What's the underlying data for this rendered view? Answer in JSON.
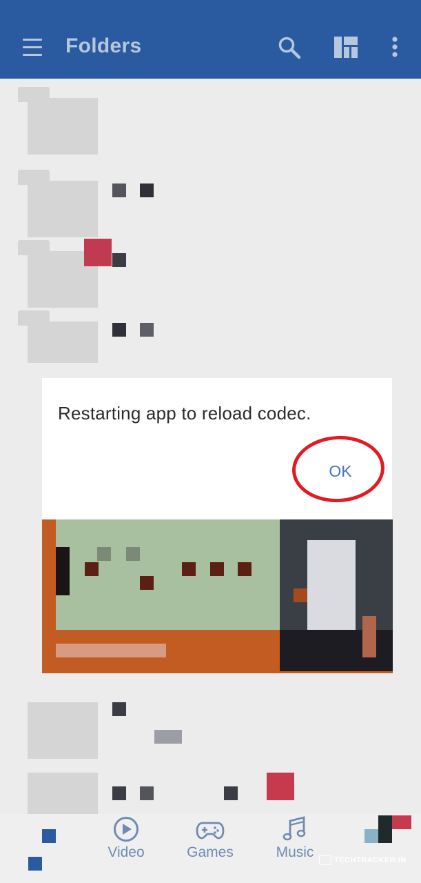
{
  "app_bar": {
    "title": "Folders",
    "icons": [
      "menu-icon",
      "search-icon",
      "grid-layout-icon",
      "more-vert-icon"
    ],
    "background": "#2a5ba1"
  },
  "dialog": {
    "message": "Restarting app to reload codec.",
    "ok_label": "OK",
    "annotation_color": "#e21b23"
  },
  "bottom_nav": {
    "items": [
      {
        "label": "Video",
        "icon": "play-circle-icon"
      },
      {
        "label": "Games",
        "icon": "gamepad-icon"
      },
      {
        "label": "Music",
        "icon": "music-note-icon"
      }
    ]
  },
  "watermark": {
    "text": "TECHTRACKER.IN"
  }
}
